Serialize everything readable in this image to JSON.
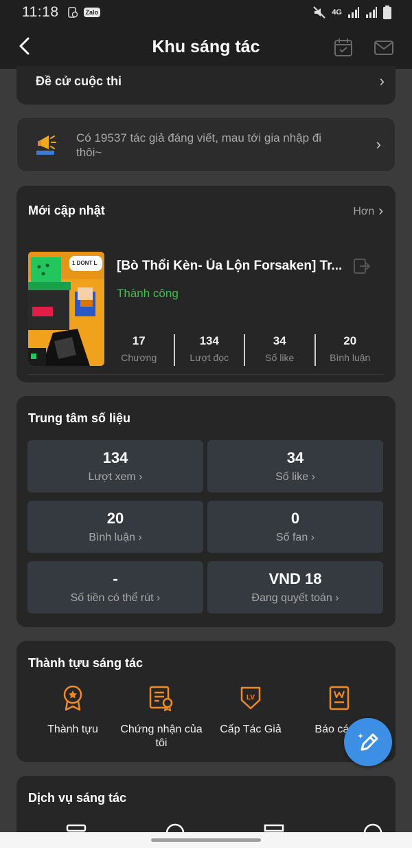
{
  "status": {
    "time": "11:18",
    "zalo": "Zalo",
    "network": "4G"
  },
  "header": {
    "title": "Khu sáng tác"
  },
  "contest": {
    "label": "Đề cử cuộc thi"
  },
  "banner": {
    "text": "Có 19537 tác giả đáng viết, mau tới gia nhập đi thôi~"
  },
  "updates": {
    "title": "Mới cập nhật",
    "more": "Hơn",
    "book": {
      "title": "[Bò Thổi Kèn- Ủa Lộn Forsaken] Tr...",
      "status": "Thành công",
      "cover_text": "1 DONT L",
      "stats": [
        {
          "value": "17",
          "label": "Chương"
        },
        {
          "value": "134",
          "label": "Lượt đọc"
        },
        {
          "value": "34",
          "label": "Số like"
        },
        {
          "value": "20",
          "label": "Bình luận"
        }
      ]
    }
  },
  "data_center": {
    "title": "Trung tâm số liệu",
    "items": [
      {
        "value": "134",
        "label": "Lượt xem"
      },
      {
        "value": "34",
        "label": "Số like"
      },
      {
        "value": "20",
        "label": "Bình luận"
      },
      {
        "value": "0",
        "label": "Số fan"
      },
      {
        "value": "-",
        "label": "Số tiền có thể rút"
      },
      {
        "value": "VND 18",
        "label": "Đang quyết toán"
      }
    ]
  },
  "achievements": {
    "title": "Thành tựu sáng tác",
    "items": [
      {
        "label": "Thành tựu",
        "icon": "medal-icon"
      },
      {
        "label": "Chứng nhận của tôi",
        "icon": "certificate-icon"
      },
      {
        "label": "Cấp Tác Giả",
        "icon": "level-shield-icon"
      },
      {
        "label": "Báo cáo v",
        "icon": "report-icon"
      }
    ]
  },
  "services": {
    "title": "Dịch vụ sáng tác"
  },
  "colors": {
    "accent_orange": "#f08a24",
    "success_green": "#3cc04a",
    "fab_blue": "#3d8fe6"
  }
}
